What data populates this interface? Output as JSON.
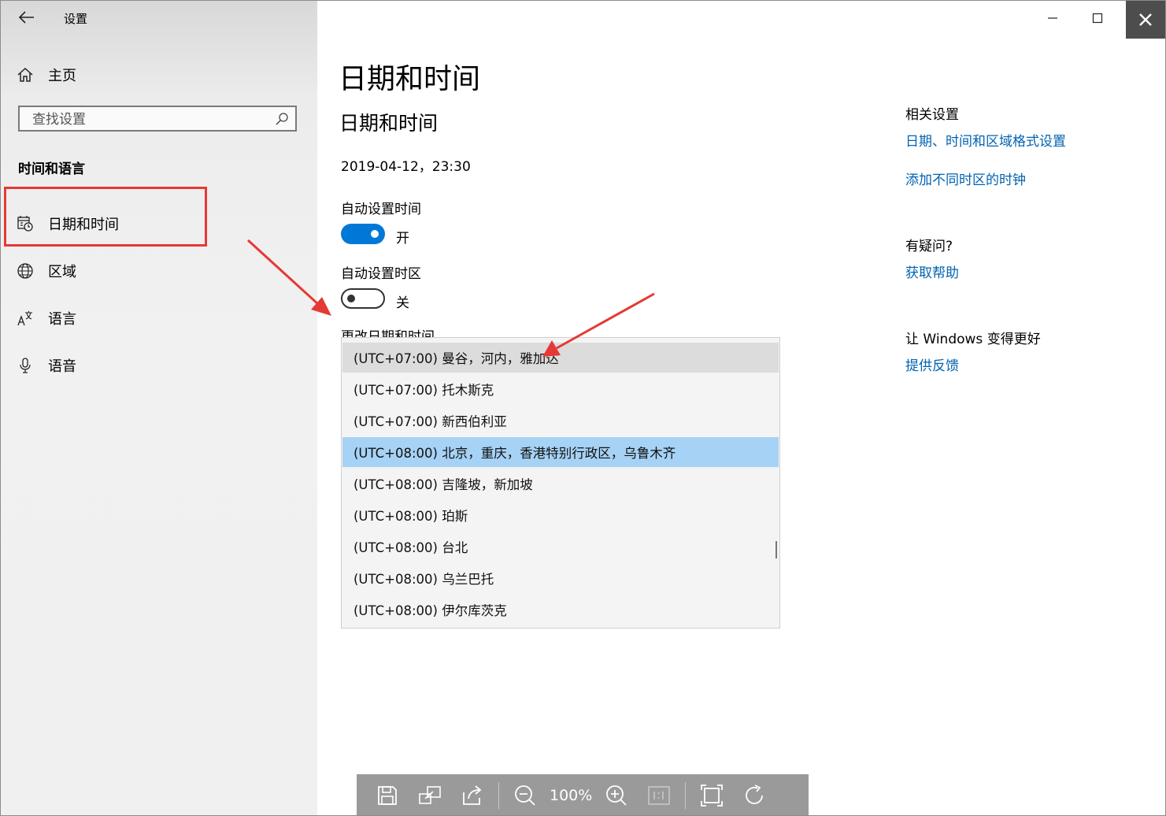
{
  "app": {
    "title": "设置"
  },
  "sidebar": {
    "home_label": "主页",
    "search_placeholder": "查找设置",
    "section_title": "时间和语言",
    "items": [
      {
        "label": "日期和时间",
        "icon": "calendar-clock-icon"
      },
      {
        "label": "区域",
        "icon": "globe-icon"
      },
      {
        "label": "语言",
        "icon": "language-icon"
      },
      {
        "label": "语音",
        "icon": "microphone-icon"
      }
    ]
  },
  "main": {
    "page_title": "日期和时间",
    "section_title": "日期和时间",
    "current_time": "2019-04-12，23:30",
    "auto_time": {
      "label": "自动设置时间",
      "state": "开"
    },
    "auto_timezone": {
      "label": "自动设置时区",
      "state": "关"
    },
    "change_label": "更改日期和时间",
    "timezones": [
      "(UTC+07:00) 曼谷，河内，雅加达",
      "(UTC+07:00) 托木斯克",
      "(UTC+07:00) 新西伯利亚",
      "(UTC+08:00) 北京，重庆，香港特别行政区，乌鲁木齐",
      "(UTC+08:00) 吉隆坡，新加坡",
      "(UTC+08:00) 珀斯",
      "(UTC+08:00) 台北",
      "(UTC+08:00) 乌兰巴托",
      "(UTC+08:00) 伊尔库茨克"
    ],
    "selected_timezone": "(UTC+08:00) 北京，重庆，香港特别行政区，乌鲁木齐"
  },
  "related": {
    "title": "相关设置",
    "link1": "日期、时间和区域格式设置",
    "link2": "添加不同时区的时钟",
    "question_title": "有疑问?",
    "help_link": "获取帮助",
    "improve_title": "让 Windows 变得更好",
    "feedback_link": "提供反馈"
  },
  "viewer": {
    "zoom": "100%"
  },
  "colors": {
    "accent": "#0078d7",
    "link": "#0063b1",
    "annotation": "#e53935",
    "selection": "#a6d2f5"
  }
}
